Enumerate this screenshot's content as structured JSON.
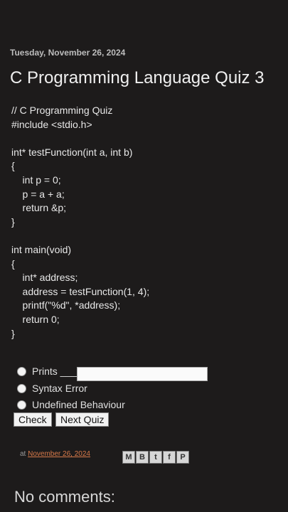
{
  "post": {
    "date": "Tuesday, November 26, 2024",
    "title": "C Programming Language Quiz 3",
    "code": "// C Programming Quiz\n#include <stdio.h>\n\nint* testFunction(int a, int b)\n{\n    int p = 0;\n    p = a + a;\n    return &p;\n}\n\nint main(void)\n{\n    int* address;\n    address = testFunction(1, 4);\n    printf(\"%d\", *address);\n    return 0;\n}"
  },
  "quiz": {
    "options": [
      "Prints ___",
      "Syntax Error",
      "Undefined Behaviour"
    ],
    "answer_value": "",
    "check_label": "Check",
    "next_label": "Next Quiz"
  },
  "footer": {
    "at_label": "at",
    "timestamp": "November 26, 2024",
    "share_icons": [
      "email-icon",
      "blog-icon",
      "twitter-icon",
      "facebook-icon",
      "pinterest-icon"
    ],
    "share_glyphs": [
      "M",
      "B",
      "t",
      "f",
      "P"
    ],
    "comments_heading": "No comments:"
  }
}
